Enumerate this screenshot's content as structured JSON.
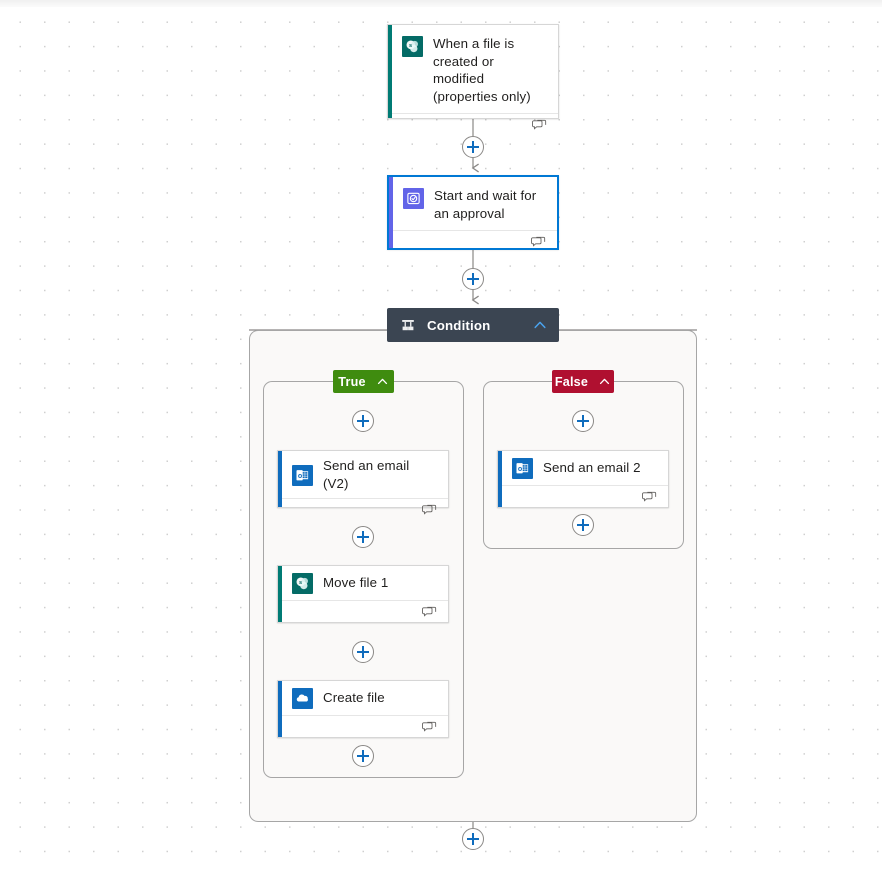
{
  "app": {
    "name": "Power Automate flow designer canvas",
    "canvas_background": "#ffffff",
    "grid_dot_color": "#cfcfcf",
    "connector_color": "#8a8886"
  },
  "colors": {
    "accent_blue": "#0f6cbd",
    "selected_border": "#0078d4",
    "sharepoint_teal": "#007b74",
    "outlook_blue": "#0f6cbd",
    "onedrive_blue": "#0f6cbd",
    "approval_purple": "#6264e8",
    "condition_header_bg": "#3b4552",
    "true_green": "#3f8c0f",
    "false_red": "#b01030",
    "scope_fill": "#faf9f8",
    "scope_border": "#a6a6a6"
  },
  "nodes": {
    "trigger": {
      "title": "When a file is created or modified (properties only)",
      "icon": "sharepoint-icon",
      "accent": "#007b74",
      "selected": false,
      "footer_icon": "comment-icon"
    },
    "approval": {
      "title": "Start and wait for an approval",
      "icon": "approvals-icon",
      "accent": "#6264e8",
      "selected": true,
      "footer_icon": "comment-icon"
    },
    "condition": {
      "title": "Condition",
      "icon": "condition-icon",
      "collapse_icon": "chevron-up-icon",
      "expanded": true
    },
    "true_branch": {
      "label": "True",
      "collapse_icon": "chevron-up-icon",
      "color": "#3f8c0f"
    },
    "false_branch": {
      "label": "False",
      "collapse_icon": "chevron-up-icon",
      "color": "#b01030"
    },
    "send_email_v2": {
      "title": "Send an email (V2)",
      "icon": "outlook-icon",
      "accent": "#0f6cbd",
      "selected": false,
      "footer_icon": "comment-icon"
    },
    "move_file_1": {
      "title": "Move file 1",
      "icon": "sharepoint-icon",
      "accent": "#007b74",
      "selected": false,
      "footer_icon": "comment-icon"
    },
    "create_file": {
      "title": "Create file",
      "icon": "onedrive-icon",
      "accent": "#0f6cbd",
      "selected": false,
      "footer_icon": "comment-icon"
    },
    "send_email_2": {
      "title": "Send an email 2",
      "icon": "outlook-icon",
      "accent": "#0f6cbd",
      "selected": false,
      "footer_icon": "comment-icon"
    }
  },
  "insert_buttons": [
    {
      "id": "insert-after-trigger",
      "label": "+"
    },
    {
      "id": "insert-after-approval",
      "label": "+"
    },
    {
      "id": "insert-true-top",
      "label": "+"
    },
    {
      "id": "insert-true-between-email-move",
      "label": "+"
    },
    {
      "id": "insert-true-between-move-create",
      "label": "+"
    },
    {
      "id": "insert-true-bottom",
      "label": "+"
    },
    {
      "id": "insert-false-top",
      "label": "+"
    },
    {
      "id": "insert-false-bottom",
      "label": "+"
    },
    {
      "id": "insert-after-condition",
      "label": "+"
    }
  ]
}
